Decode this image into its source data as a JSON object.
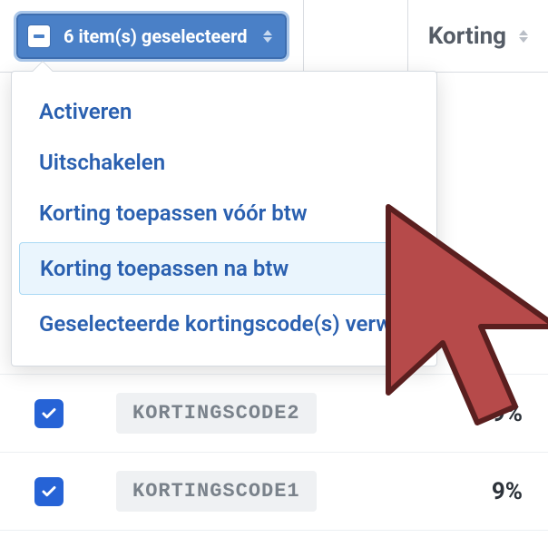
{
  "header": {
    "bulk_label": "6 item(s) geselecteerd",
    "korting_label": "Korting"
  },
  "dropdown": {
    "items": [
      {
        "label": "Activeren"
      },
      {
        "label": "Uitschakelen"
      },
      {
        "label": "Korting toepassen vóór btw"
      },
      {
        "label": "Korting toepassen na btw",
        "highlighted": true
      },
      {
        "label": "Geselecteerde kortingscode(s) verwijderen"
      }
    ]
  },
  "rows": [
    {
      "code": "KORTINGSCODE2",
      "discount": "9%"
    },
    {
      "code": "KORTINGSCODE1",
      "discount": "9%"
    }
  ]
}
